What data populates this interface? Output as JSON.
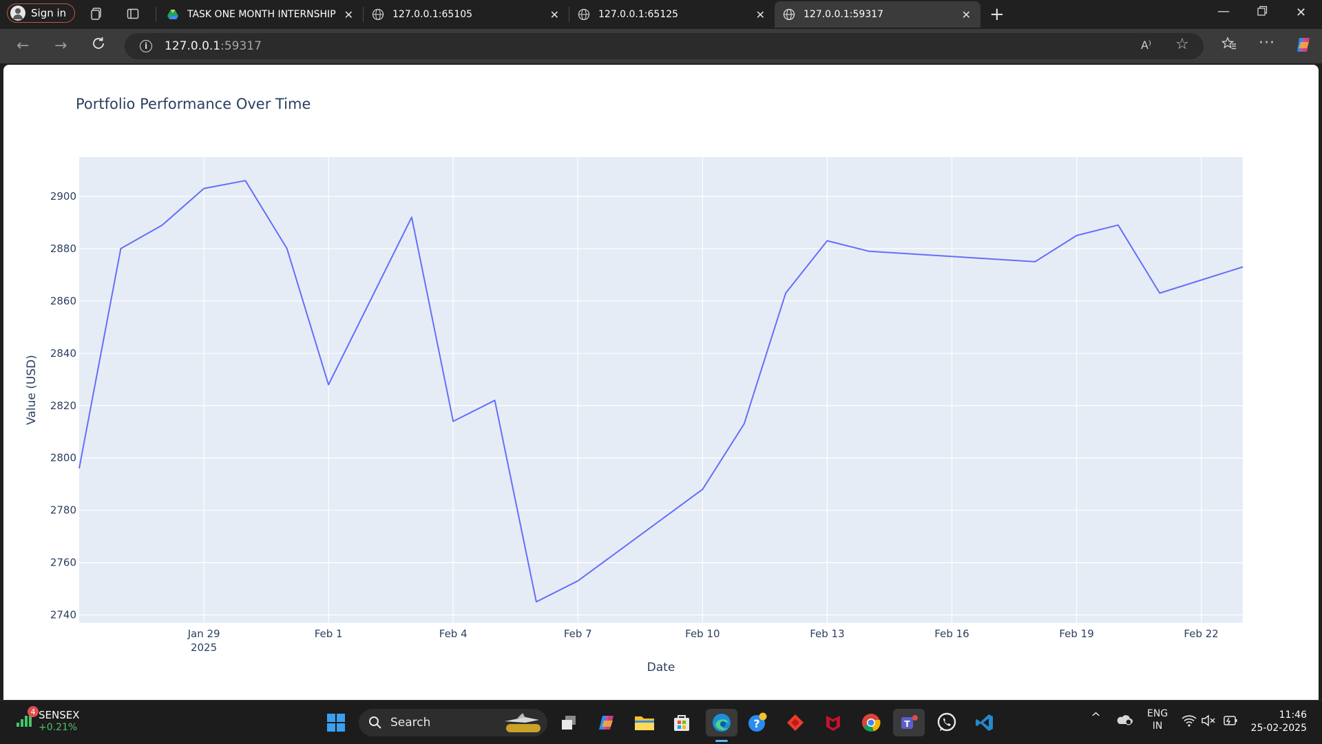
{
  "browser": {
    "signin_label": "Sign in",
    "tabs": [
      {
        "title": "TASK ONE MONTH INTERNSHIP -"
      },
      {
        "title": "127.0.0.1:65105"
      },
      {
        "title": "127.0.0.1:65125"
      },
      {
        "title": "127.0.0.1:59317"
      }
    ],
    "active_tab": 3,
    "url_host": "127.0.0.1",
    "url_port": ":59317",
    "read_aloud_label": "A⁾"
  },
  "chart_data": {
    "type": "line",
    "title": "Portfolio Performance Over Time",
    "xlabel": "Date",
    "ylabel": "Value (USD)",
    "x_start": "2025-01-26",
    "x_end": "2025-02-23",
    "ylim": [
      2737,
      2915
    ],
    "yticks": [
      2740,
      2760,
      2780,
      2800,
      2820,
      2840,
      2860,
      2880,
      2900
    ],
    "xticks": [
      {
        "date": "2025-01-29",
        "label": "Jan 29",
        "sublabel": "2025"
      },
      {
        "date": "2025-02-01",
        "label": "Feb 1"
      },
      {
        "date": "2025-02-04",
        "label": "Feb 4"
      },
      {
        "date": "2025-02-07",
        "label": "Feb 7"
      },
      {
        "date": "2025-02-10",
        "label": "Feb 10"
      },
      {
        "date": "2025-02-13",
        "label": "Feb 13"
      },
      {
        "date": "2025-02-16",
        "label": "Feb 16"
      },
      {
        "date": "2025-02-19",
        "label": "Feb 19"
      },
      {
        "date": "2025-02-22",
        "label": "Feb 22"
      }
    ],
    "grid": true,
    "line_color": "#636efa",
    "plot_bg": "#e5ecf6",
    "series": [
      {
        "x": [
          "2025-01-26",
          "2025-01-27",
          "2025-01-28",
          "2025-01-29",
          "2025-01-30",
          "2025-01-31",
          "2025-02-01",
          "2025-02-03",
          "2025-02-04",
          "2025-02-05",
          "2025-02-06",
          "2025-02-07",
          "2025-02-10",
          "2025-02-11",
          "2025-02-12",
          "2025-02-13",
          "2025-02-14",
          "2025-02-18",
          "2025-02-19",
          "2025-02-20",
          "2025-02-21",
          "2025-02-23"
        ],
        "y": [
          2796,
          2880,
          2889,
          2903,
          2906,
          2880,
          2828,
          2892,
          2814,
          2822,
          2745,
          2753,
          2788,
          2813,
          2863,
          2883,
          2879,
          2875,
          2885,
          2889,
          2863,
          2873
        ]
      }
    ]
  },
  "taskbar": {
    "ticker_name": "SENSEX",
    "ticker_change": "+0.21%",
    "ticker_badge": "4",
    "search_label": "Search",
    "lang_line1": "ENG",
    "lang_line2": "IN",
    "time": "11:46",
    "date": "25-02-2025"
  }
}
